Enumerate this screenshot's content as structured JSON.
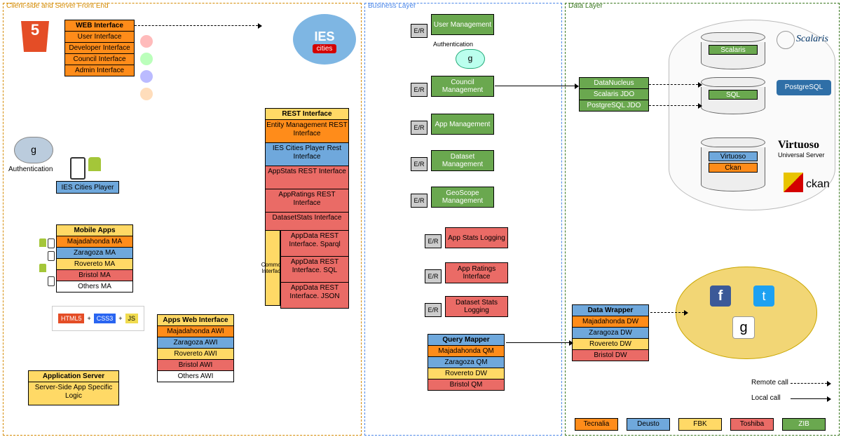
{
  "layers": {
    "client": "Client-side and Server Front End",
    "business": "Business Layer",
    "data": "Data Layer"
  },
  "webInterface": {
    "title": "WEB Interface",
    "items": [
      "User Interface",
      "Developer Interface",
      "Council Interface",
      "Admin Interface"
    ]
  },
  "authentication": "Authentication",
  "iesCitiesPlayer": "IES Cities Player",
  "mobileApps": {
    "title": "Mobile Apps",
    "items": [
      "Majadahonda MA",
      "Zaragoza MA",
      "Rovereto MA",
      "Bristol MA",
      "Others MA"
    ],
    "classes": [
      "orange",
      "blue",
      "yellow",
      "red",
      "white"
    ]
  },
  "appsWebInterface": {
    "title": "Apps Web Interface",
    "items": [
      "Majadahonda AWI",
      "Zaragoza AWI",
      "Rovereto AWI",
      "Bristol AWI",
      "Others AWI"
    ],
    "classes": [
      "orange",
      "blue",
      "yellow",
      "red",
      "white"
    ]
  },
  "appServer": {
    "title": "Application Server",
    "items": [
      "Server-Side App Specific Logic"
    ],
    "classes": [
      "yellow"
    ]
  },
  "restInterface": {
    "title": "REST Interface",
    "items": [
      "Entity Management REST Interface",
      "IES Cities Player Rest Interface",
      "AppStats REST Interface",
      "AppRatings REST Interface",
      "DatasetStats Interface"
    ],
    "classes": [
      "orange",
      "blue",
      "red",
      "red",
      "red"
    ]
  },
  "commonInterface": {
    "title": "Common Interface",
    "items": [
      "AppData REST Interface. Sparql",
      "AppData REST Interface. SQL",
      "AppData REST Interface. JSON"
    ],
    "classes": [
      "red",
      "red",
      "red"
    ]
  },
  "er": "E/R",
  "managements": [
    "User Management",
    "Council Management",
    "App Management",
    "Dataset Management",
    "GeoScope Management"
  ],
  "authLabel": "Authentication",
  "loggings": [
    "App Stats Logging",
    "App Ratings Interface",
    "Dataset Stats Logging"
  ],
  "queryMapper": {
    "title": "Query Mapper",
    "items": [
      "Majadahonda QM",
      "Zaragoza QM",
      "Rovereto DW",
      "Bristol QM"
    ],
    "classes": [
      "orange",
      "blue",
      "yellow",
      "red"
    ]
  },
  "dataNucleusStack": [
    "DataNucleus",
    "Scalaris JDO",
    "PostgreSQL JDO"
  ],
  "dbItems1": [
    "Scalaris",
    "SQL"
  ],
  "dbItems2": [
    "Virtuoso",
    "Ckan"
  ],
  "dataWrapper": {
    "title": "Data Wrapper",
    "items": [
      "Majadahonda DW",
      "Zaragoza DW",
      "Rovereto DW",
      "Bristol DW"
    ],
    "classes": [
      "orange",
      "blue",
      "yellow",
      "red"
    ]
  },
  "brands": {
    "scalaris": "Scalaris",
    "postgres": "PostgreSQL",
    "virtuoso": "Virtuoso",
    "virtuosoSub": "Universal Server",
    "ckan": "ckan"
  },
  "calls": {
    "remote": "Remote call",
    "local": "Local call"
  },
  "legend": [
    {
      "c": "orange",
      "t": "Tecnalia"
    },
    {
      "c": "blue",
      "t": "Deusto"
    },
    {
      "c": "yellow",
      "t": "FBK"
    },
    {
      "c": "red",
      "t": "Toshiba"
    },
    {
      "c": "green",
      "t": "ZIB"
    }
  ],
  "html5": "5",
  "ies": "IES",
  "cities": "cities"
}
